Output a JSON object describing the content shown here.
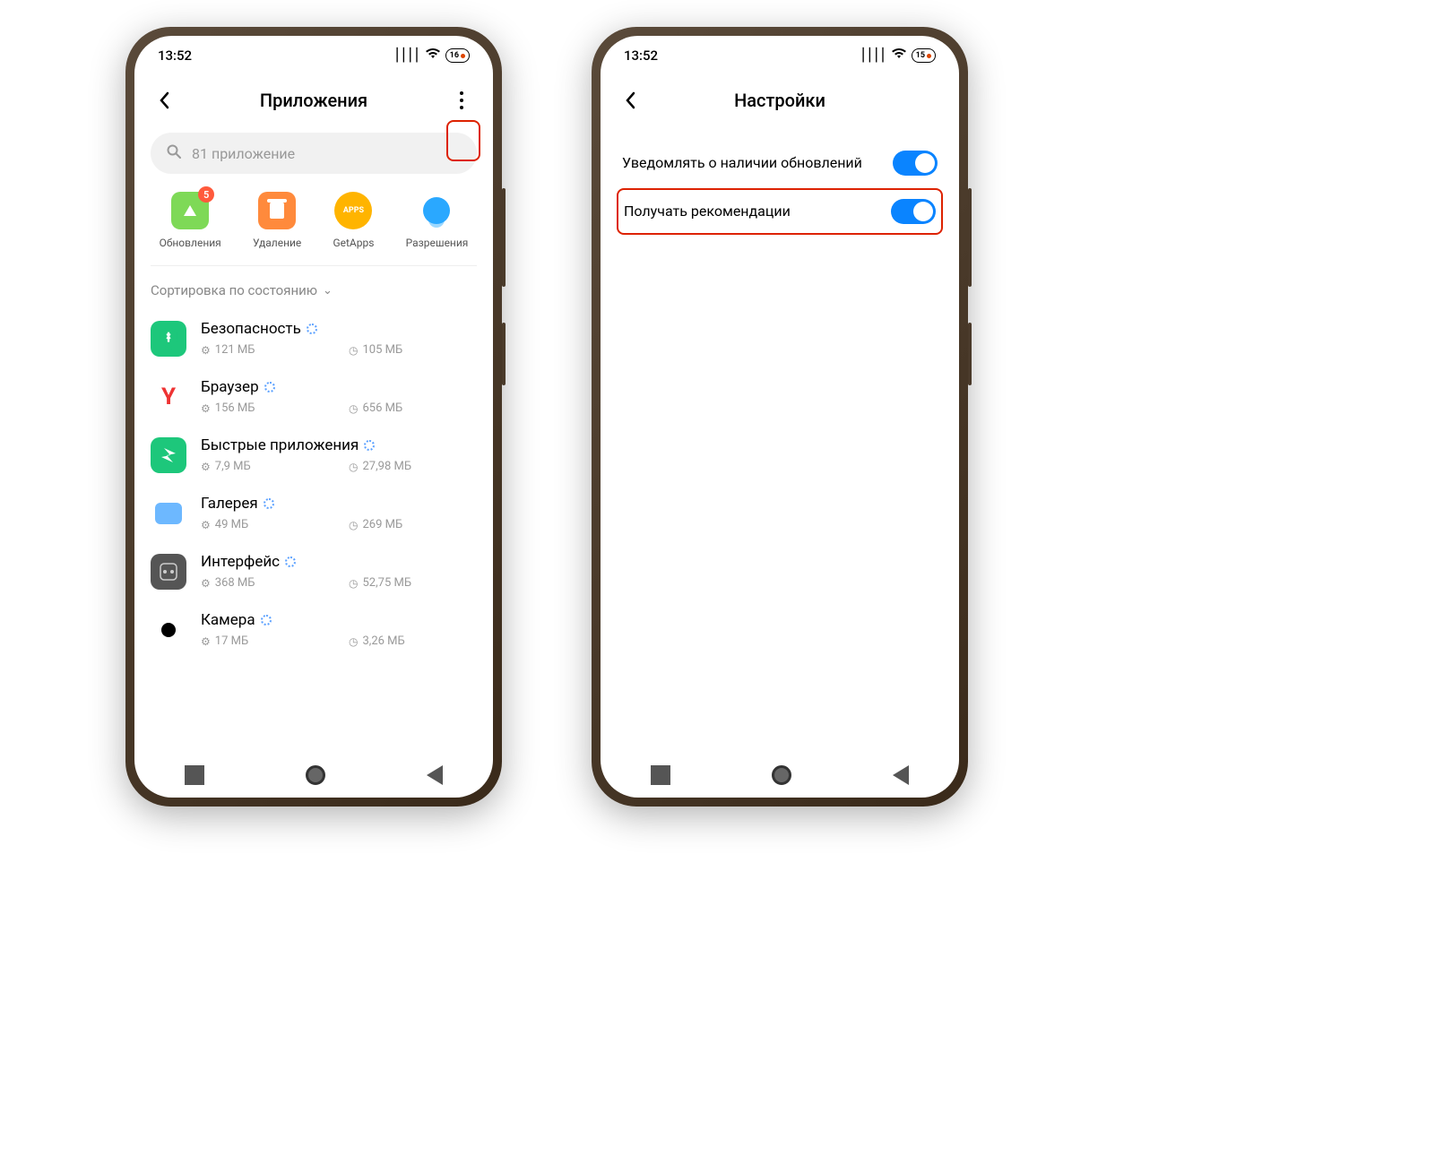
{
  "left": {
    "time": "13:52",
    "battery": "16",
    "title": "Приложения",
    "search_placeholder": "81 приложение",
    "actions": {
      "updates_label": "Обновления",
      "updates_badge": "5",
      "delete_label": "Удаление",
      "getapps_label": "GetApps",
      "getapps_icon_text": "APPS",
      "permissions_label": "Разрешения"
    },
    "sort_label": "Сортировка по состоянию",
    "apps": [
      {
        "name": "Безопасность",
        "storage": "121 МБ",
        "time": "105 МБ"
      },
      {
        "name": "Браузер",
        "storage": "156 МБ",
        "time": "656 МБ"
      },
      {
        "name": "Быстрые приложения",
        "storage": "7,9 МБ",
        "time": "27,98 МБ"
      },
      {
        "name": "Галерея",
        "storage": "49 МБ",
        "time": "269 МБ"
      },
      {
        "name": "Интерфейс",
        "storage": "368 МБ",
        "time": "52,75 МБ"
      },
      {
        "name": "Камера",
        "storage": "17 МБ",
        "time": "3,26 МБ"
      }
    ]
  },
  "right": {
    "time": "13:52",
    "battery": "15",
    "title": "Настройки",
    "settings": [
      {
        "label": "Уведомлять о наличии обновлений"
      },
      {
        "label": "Получать рекомендации"
      }
    ]
  }
}
